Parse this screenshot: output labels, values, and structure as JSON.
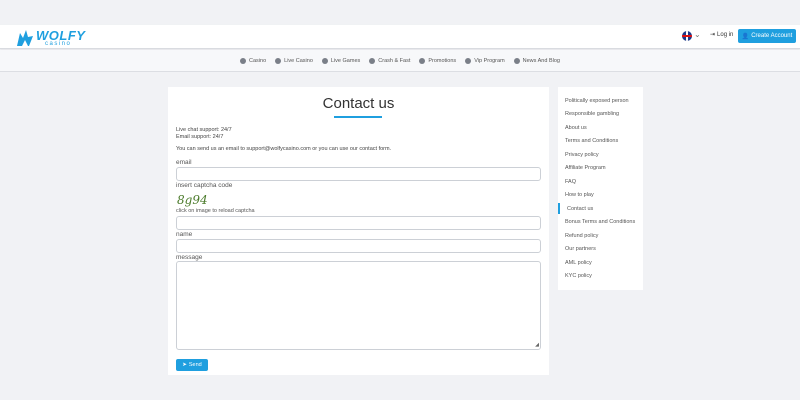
{
  "header": {
    "logo_text": "WOLFY",
    "logo_sub": "casino",
    "login_label": "Log in",
    "create_label": "Create Account",
    "language_flag": "uk-flag-icon",
    "accent_color": "#1f9fdf"
  },
  "nav": {
    "items": [
      {
        "label": "Casino",
        "icon": "casino-icon"
      },
      {
        "label": "Live Casino",
        "icon": "live-casino-icon"
      },
      {
        "label": "Live Games",
        "icon": "live-games-icon"
      },
      {
        "label": "Crash & Fast",
        "icon": "crash-fast-icon"
      },
      {
        "label": "Promotions",
        "icon": "promotions-icon"
      },
      {
        "label": "Vip Program",
        "icon": "vip-icon"
      },
      {
        "label": "News And Blog",
        "icon": "news-icon"
      }
    ]
  },
  "contact": {
    "title": "Contact us",
    "live_chat": "Live chat support: 24/7",
    "email_support": "Email support: 24/7",
    "intro": "You can send us an email to support@wolfycasino.com or you can use our contact form.",
    "email_label": "email",
    "captcha_label": "insert captcha code",
    "captcha_text": "8g94",
    "captcha_hint": "click on image to reload captcha",
    "name_label": "name",
    "message_label": "message",
    "send_label": "Send"
  },
  "sidebar": {
    "items": [
      {
        "label": "Politically exposed person",
        "active": false
      },
      {
        "label": "Responsible gambling",
        "active": false
      },
      {
        "label": "About us",
        "active": false
      },
      {
        "label": "Terms and Conditions",
        "active": false
      },
      {
        "label": "Privacy policy",
        "active": false
      },
      {
        "label": "Affiliate Program",
        "active": false
      },
      {
        "label": "FAQ",
        "active": false
      },
      {
        "label": "How to play",
        "active": false
      },
      {
        "label": "Contact us",
        "active": true
      },
      {
        "label": "Bonus Terms and Conditions",
        "active": false
      },
      {
        "label": "Refund policy",
        "active": false
      },
      {
        "label": "Our partners",
        "active": false
      },
      {
        "label": "AML policy",
        "active": false
      },
      {
        "label": "KYC policy",
        "active": false
      }
    ]
  }
}
